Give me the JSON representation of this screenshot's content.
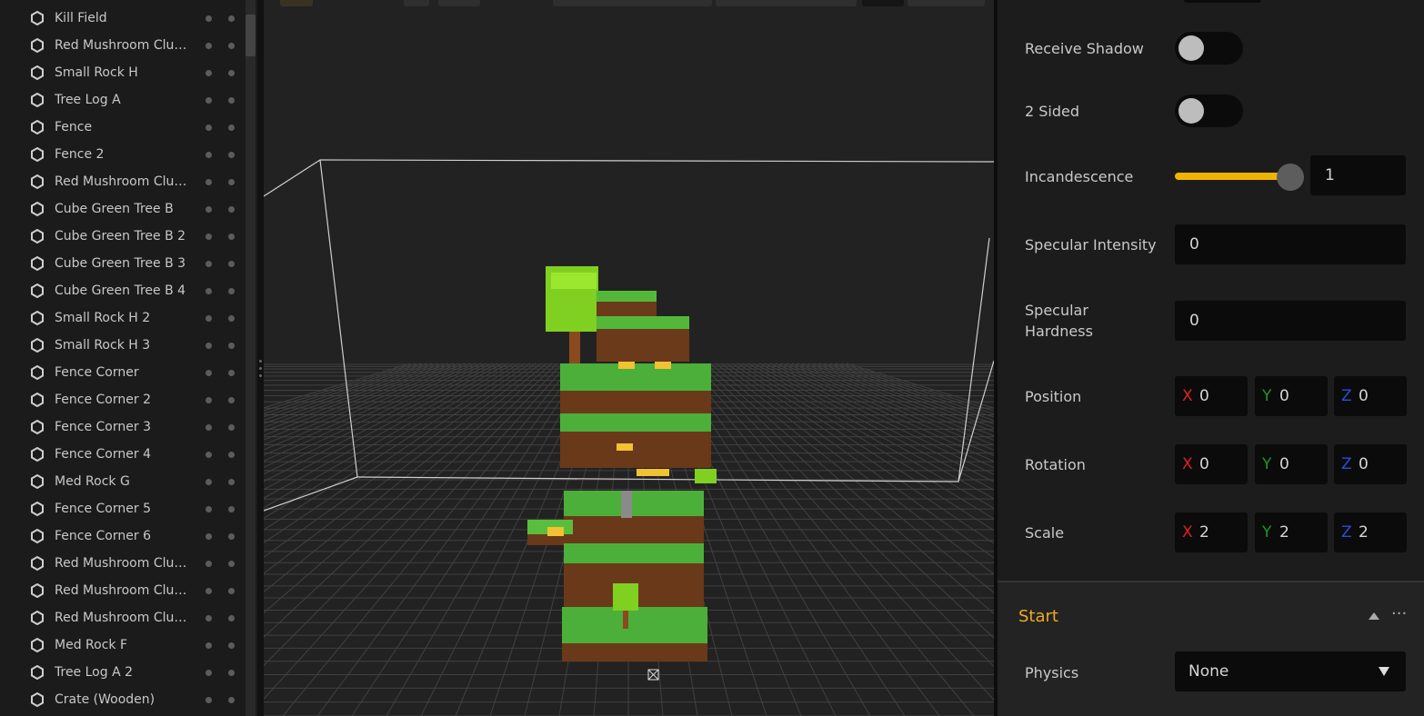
{
  "hierarchy": {
    "items": [
      "Kill Field",
      "Red Mushroom Clus...",
      "Small Rock H",
      "Tree Log A",
      "Fence",
      "Fence 2",
      "Red Mushroom Clus...",
      "Cube Green Tree B",
      "Cube Green Tree B 2",
      "Cube Green Tree B 3",
      "Cube Green Tree B 4",
      "Small Rock H 2",
      "Small Rock H 3",
      "Fence Corner",
      "Fence Corner 2",
      "Fence Corner 3",
      "Fence Corner 4",
      "Med Rock G",
      "Fence Corner 5",
      "Fence Corner 6",
      "Red Mushroom Clus...",
      "Red Mushroom Clus...",
      "Red Mushroom Clus...",
      "Med Rock F",
      "Tree Log A 2",
      "Crate (Wooden)"
    ],
    "item_icon": "hexagon-icon"
  },
  "inspector": {
    "receive_shadow": {
      "label": "Receive Shadow",
      "on": false
    },
    "two_sided": {
      "label": "2 Sided",
      "on": false
    },
    "incandescence": {
      "label": "Incandescence",
      "value": "1"
    },
    "specular_intensity": {
      "label": "Specular Intensity",
      "value": "0"
    },
    "specular_hardness": {
      "label_line1": "Specular",
      "label_line2": "Hardness",
      "value": "0"
    },
    "axes": {
      "x": "X",
      "y": "Y",
      "z": "Z"
    },
    "position": {
      "label": "Position",
      "x": "0",
      "y": "0",
      "z": "0"
    },
    "rotation": {
      "label": "Rotation",
      "x": "0",
      "y": "0",
      "z": "0"
    },
    "scale": {
      "label": "Scale",
      "x": "2",
      "y": "2",
      "z": "2"
    },
    "start": {
      "title": "Start",
      "more": "···",
      "physics": {
        "label": "Physics",
        "value": "None"
      }
    }
  },
  "colors": {
    "accent": "#f0b400",
    "section_title": "#f0a920",
    "axis_x": "#e02020",
    "axis_y": "#1a9a1a",
    "axis_z": "#2a4fd6"
  }
}
